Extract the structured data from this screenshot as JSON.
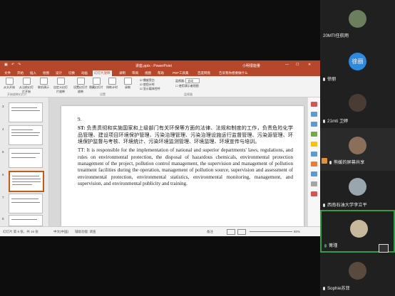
{
  "app": {
    "title": "讲座.pptx - PowerPoint",
    "user": "小明很能量",
    "tabs": [
      "文件",
      "开始",
      "插入",
      "绘图",
      "设计",
      "切换",
      "动画",
      "幻灯片放映",
      "录制",
      "审阅",
      "视图",
      "帮助",
      "PDF工具集",
      "百度网盘",
      "告诉我你想要做什么"
    ],
    "active_tab": "幻灯片放映"
  },
  "ribbon": {
    "buttons": [
      "从头开始",
      "从当前幻灯片开始",
      "联机演示",
      "自定义幻灯片放映",
      "设置幻灯片放映",
      "隐藏幻灯片",
      "排练计时",
      "录制"
    ],
    "checks": [
      "播放旁白",
      "使用计时",
      "显示媒体控件"
    ],
    "monitor_label": "监视器",
    "monitor_value": "自动",
    "presenter_label": "使用演示者视图",
    "groups": [
      "开始放映幻灯片",
      "设置",
      "监视器"
    ]
  },
  "thumbnails": [
    {
      "num": "3"
    },
    {
      "num": "4"
    },
    {
      "num": "5"
    },
    {
      "num": "6",
      "selected": true
    },
    {
      "num": "7"
    },
    {
      "num": "8"
    }
  ],
  "slide": {
    "number": "9.",
    "st_label": "ST:",
    "st_text": "负责贯彻和实施国家和上级部门有关环保等方面的法律、法规和制度的工作，负责危险化学品管理、建设项目环境保护管理、污染治理管理、污染治理设施运行监督管理、污染源管理、环境保护监督与考核、环境统计、污染环境监测管理、环境监理、环境宣传与培训。",
    "tt_label": "TT:",
    "tt_text": "It is responsible for the implementation of national and superior departments' laws, regulations, and rules on environmental protection, the disposal of hazardous chemicals, environmental protection management of the project, pollution control management, the supervision and management of pollution treatment facilities during the operation, management of pollution source, supervision and assessment of environmental protection, environmental statistics, environmental monitoring, management, and supervision, and environmental publicity and training."
  },
  "status": {
    "slide_info": "幻灯片 第 6 张，共 16 张",
    "language": "中文(中国)",
    "accessibility": "辅助功能: 调查",
    "notes": "备注",
    "zoom": "80%"
  },
  "participants": [
    {
      "name": "20MTI任航雨",
      "color": "#6b7f5e"
    },
    {
      "name": "徐丽",
      "color": "#2b8ae2",
      "initials": "徐丽"
    },
    {
      "name": "21mti 卫婷",
      "color": "#4a3b33"
    },
    {
      "name": "熊媛的屏幕共享",
      "color": "#8b6f5a"
    },
    {
      "name": "西南石油大学李立平",
      "color": "#9aa6ad"
    },
    {
      "name": "菁瑾",
      "color": "#c7b79b"
    },
    {
      "name": "Sophie苏菲",
      "color": "#5a4a3e"
    }
  ]
}
